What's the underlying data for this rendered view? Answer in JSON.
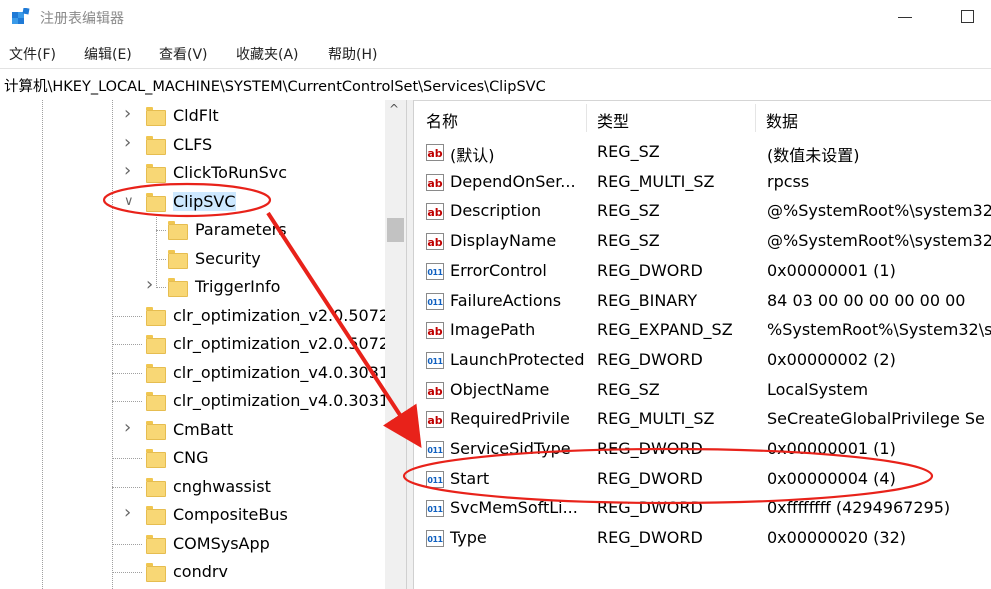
{
  "window": {
    "title": "注册表编辑器",
    "app_icon": "registry-editor-icon",
    "controls": [
      "minimize-icon",
      "maximize-icon"
    ]
  },
  "menu": [
    "文件(F)",
    "编辑(E)",
    "查看(V)",
    "收藏夹(A)",
    "帮助(H)"
  ],
  "address": "计算机\\HKEY_LOCAL_MACHINE\\SYSTEM\\CurrentControlSet\\Services\\ClipSVC",
  "tree": {
    "items": [
      {
        "label": "CldFlt",
        "expandable": true
      },
      {
        "label": "CLFS",
        "expandable": true
      },
      {
        "label": "ClickToRunSvc",
        "expandable": true
      },
      {
        "label": "ClipSVC",
        "expanded": true,
        "selected": true
      },
      {
        "label": "Parameters",
        "child": true
      },
      {
        "label": "Security",
        "child": true
      },
      {
        "label": "TriggerInfo",
        "child": true,
        "expandable": true
      },
      {
        "label": "clr_optimization_v2.0.5072"
      },
      {
        "label": "clr_optimization_v2.0.5072"
      },
      {
        "label": "clr_optimization_v4.0.3031"
      },
      {
        "label": "clr_optimization_v4.0.3031"
      },
      {
        "label": "CmBatt",
        "expandable": true
      },
      {
        "label": "CNG"
      },
      {
        "label": "cnghwassist"
      },
      {
        "label": "CompositeBus",
        "expandable": true
      },
      {
        "label": "COMSysApp"
      },
      {
        "label": "condrv"
      }
    ]
  },
  "columns": {
    "name": "名称",
    "type": "类型",
    "data": "数据"
  },
  "values": [
    {
      "name": "(默认)",
      "type": "REG_SZ",
      "data": "(数值未设置)",
      "icon": "string-value-icon"
    },
    {
      "name": "DependOnSer...",
      "type": "REG_MULTI_SZ",
      "data": "rpcss",
      "icon": "string-value-icon"
    },
    {
      "name": "Description",
      "type": "REG_SZ",
      "data": "@%SystemRoot%\\system32",
      "icon": "string-value-icon"
    },
    {
      "name": "DisplayName",
      "type": "REG_SZ",
      "data": "@%SystemRoot%\\system32",
      "icon": "string-value-icon"
    },
    {
      "name": "ErrorControl",
      "type": "REG_DWORD",
      "data": "0x00000001 (1)",
      "icon": "binary-value-icon"
    },
    {
      "name": "FailureActions",
      "type": "REG_BINARY",
      "data": "84 03 00 00 00 00 00 00",
      "icon": "binary-value-icon"
    },
    {
      "name": "ImagePath",
      "type": "REG_EXPAND_SZ",
      "data": "%SystemRoot%\\System32\\s",
      "icon": "string-value-icon"
    },
    {
      "name": "LaunchProtected",
      "type": "REG_DWORD",
      "data": "0x00000002 (2)",
      "icon": "binary-value-icon"
    },
    {
      "name": "ObjectName",
      "type": "REG_SZ",
      "data": "LocalSystem",
      "icon": "string-value-icon"
    },
    {
      "name": "RequiredPrivile",
      "type": "REG_MULTI_SZ",
      "data": "SeCreateGlobalPrivilege Se",
      "icon": "string-value-icon"
    },
    {
      "name": "ServiceSidType",
      "type": "REG_DWORD",
      "data": "0x00000001 (1)",
      "icon": "binary-value-icon"
    },
    {
      "name": "Start",
      "type": "REG_DWORD",
      "data": "0x00000004 (4)",
      "icon": "binary-value-icon"
    },
    {
      "name": "SvcMemSoftLi...",
      "type": "REG_DWORD",
      "data": "0xffffffff (4294967295)",
      "icon": "binary-value-icon"
    },
    {
      "name": "Type",
      "type": "REG_DWORD",
      "data": "0x00000020 (32)",
      "icon": "binary-value-icon"
    }
  ],
  "icon_glyphs": {
    "string": "ab",
    "binary": "011"
  },
  "annotation": {
    "color": "#e8221a",
    "marks": [
      "ellipse-clipsvc",
      "ellipse-start",
      "arrow"
    ]
  }
}
